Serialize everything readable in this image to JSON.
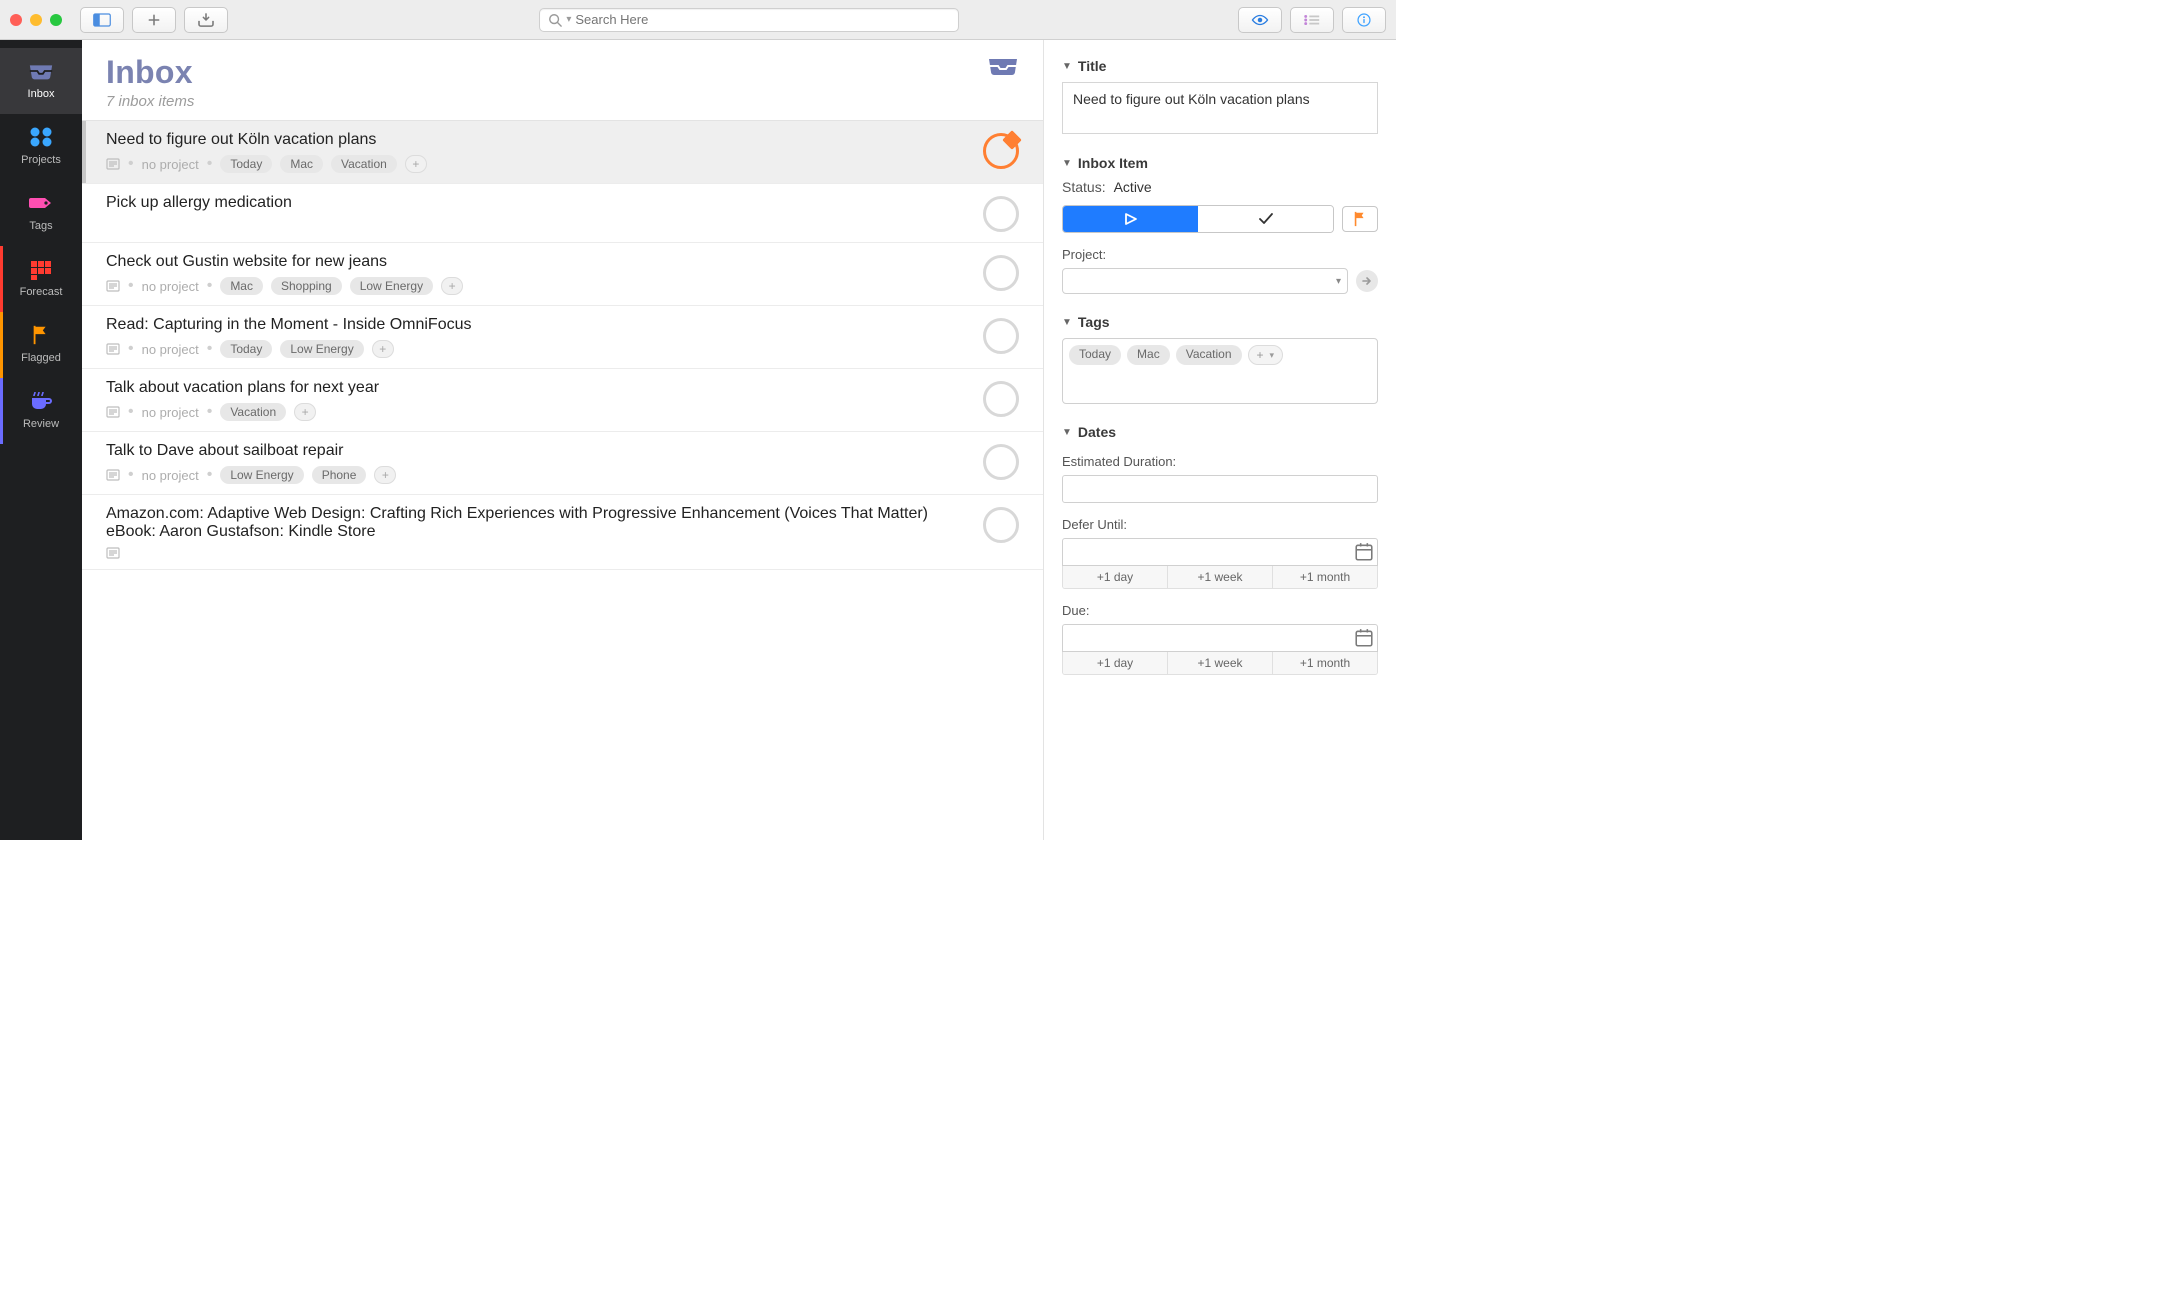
{
  "search": {
    "placeholder": "Search Here"
  },
  "sidebar": {
    "items": [
      {
        "label": "Inbox",
        "icon": "inbox-icon",
        "color": "#6f7ab3",
        "active": true
      },
      {
        "label": "Projects",
        "icon": "projects-icon",
        "color": "#3aa7ff",
        "active": false
      },
      {
        "label": "Tags",
        "icon": "tag-icon",
        "color": "#ff4fb2",
        "active": false
      },
      {
        "label": "Forecast",
        "icon": "calendar-icon",
        "color": "#ff3b30",
        "active": false
      },
      {
        "label": "Flagged",
        "icon": "flag-icon",
        "color": "#ff9500",
        "active": false
      },
      {
        "label": "Review",
        "icon": "coffee-icon",
        "color": "#6b6cff",
        "active": false
      }
    ]
  },
  "header": {
    "title": "Inbox",
    "subtitle": "7 inbox items"
  },
  "no_project_label": "no project",
  "items": [
    {
      "title": "Need to figure out Köln vacation plans",
      "has_note": true,
      "no_project": true,
      "tags": [
        "Today",
        "Mac",
        "Vacation"
      ],
      "flagged": true,
      "selected": true
    },
    {
      "title": "Pick up allergy medication",
      "has_note": false,
      "no_project": false,
      "tags": [],
      "flagged": false,
      "selected": false
    },
    {
      "title": "Check out Gustin website for new jeans",
      "has_note": true,
      "no_project": true,
      "tags": [
        "Mac",
        "Shopping",
        "Low Energy"
      ],
      "flagged": false,
      "selected": false
    },
    {
      "title": "Read: Capturing in the Moment - Inside OmniFocus",
      "has_note": true,
      "no_project": true,
      "tags": [
        "Today",
        "Low Energy"
      ],
      "flagged": false,
      "selected": false
    },
    {
      "title": "Talk about vacation plans for next year",
      "has_note": true,
      "no_project": true,
      "tags": [
        "Vacation"
      ],
      "flagged": false,
      "selected": false
    },
    {
      "title": "Talk to Dave about sailboat repair",
      "has_note": true,
      "no_project": true,
      "tags": [
        "Low Energy",
        "Phone"
      ],
      "flagged": false,
      "selected": false
    },
    {
      "title": "Amazon.com: Adaptive Web Design: Crafting Rich Experiences with Progressive Enhancement (Voices That Matter) eBook: Aaron Gustafson: Kindle Store",
      "has_note": true,
      "no_project": false,
      "tags": [],
      "flagged": false,
      "selected": false
    }
  ],
  "inspector": {
    "sections": {
      "title": "Title",
      "inbox_item": "Inbox Item",
      "tags": "Tags",
      "dates": "Dates"
    },
    "title_value": "Need to figure out Köln vacation plans",
    "status_label": "Status:",
    "status_value": "Active",
    "project_label": "Project:",
    "project_value": "",
    "tags": [
      "Today",
      "Mac",
      "Vacation"
    ],
    "estimated_label": "Estimated Duration:",
    "estimated_value": "",
    "defer_label": "Defer Until:",
    "defer_value": "",
    "due_label": "Due:",
    "due_value": "",
    "quick_dates": [
      "+1 day",
      "+1 week",
      "+1 month"
    ]
  }
}
